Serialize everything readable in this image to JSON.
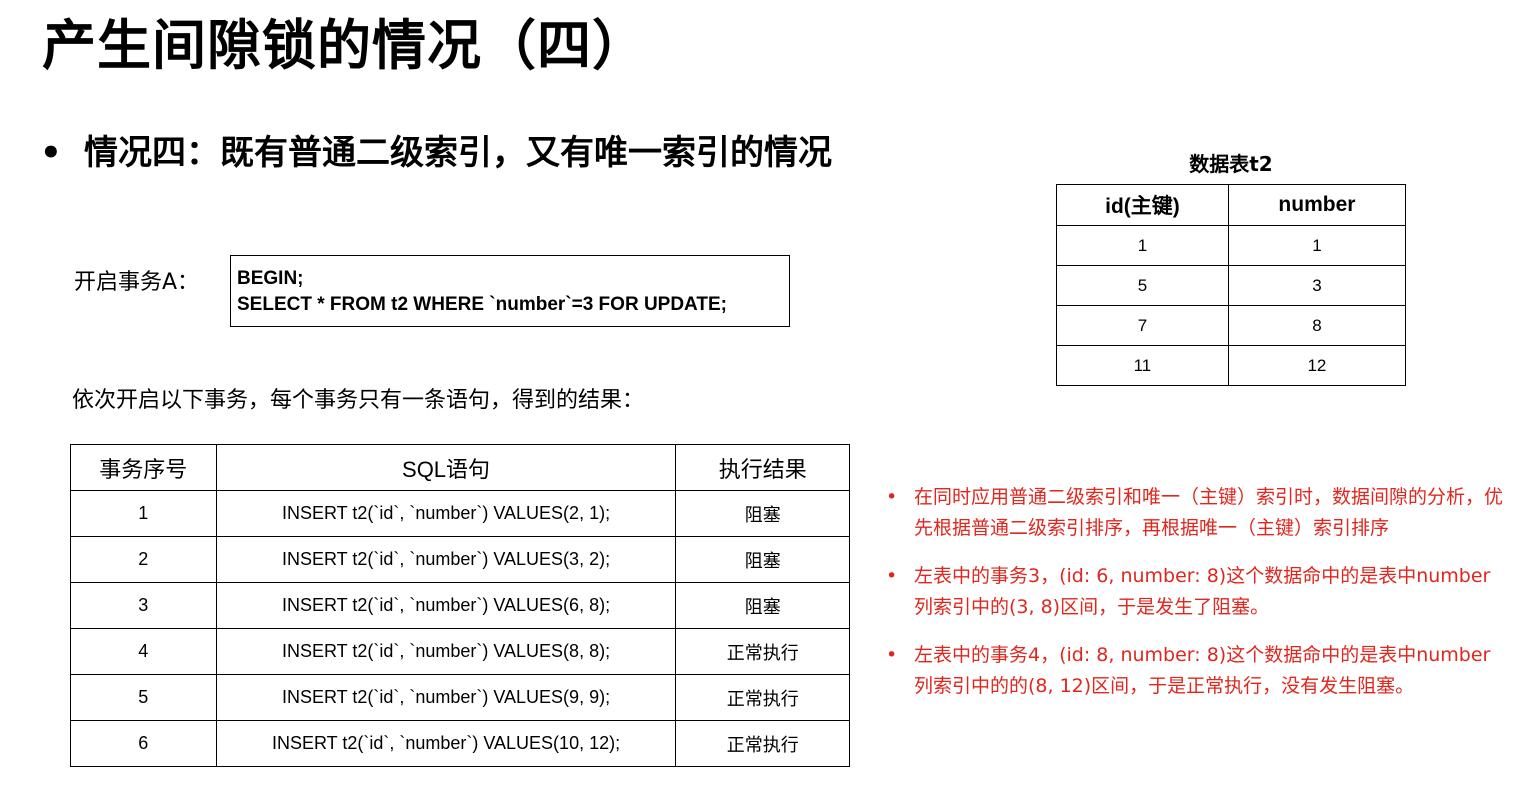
{
  "title": "产生间隙锁的情况（四）",
  "bullet": {
    "dot": "•",
    "text": "情况四：既有普通二级索引，又有唯一索引的情况"
  },
  "transaction_a": {
    "label": "开启事务A：",
    "line1": "BEGIN;",
    "line2": "SELECT * FROM t2 WHERE `number`=3 FOR UPDATE;"
  },
  "intro": "依次开启以下事务，每个事务只有一条语句，得到的结果：",
  "main_table": {
    "headers": [
      "事务序号",
      "SQL语句",
      "执行结果"
    ],
    "rows": [
      [
        "1",
        "INSERT t2(`id`, `number`) VALUES(2, 1);",
        "阻塞"
      ],
      [
        "2",
        "INSERT t2(`id`, `number`) VALUES(3, 2);",
        "阻塞"
      ],
      [
        "3",
        "INSERT t2(`id`, `number`) VALUES(6, 8);",
        "阻塞"
      ],
      [
        "4",
        "INSERT t2(`id`, `number`) VALUES(8, 8);",
        "正常执行"
      ],
      [
        "5",
        "INSERT t2(`id`, `number`) VALUES(9, 9);",
        "正常执行"
      ],
      [
        "6",
        "INSERT t2(`id`, `number`) VALUES(10, 12);",
        "正常执行"
      ]
    ]
  },
  "t2_table": {
    "caption": "数据表t2",
    "headers": [
      "id(主键)",
      "number"
    ],
    "rows": [
      [
        "1",
        "1"
      ],
      [
        "5",
        "3"
      ],
      [
        "7",
        "8"
      ],
      [
        "11",
        "12"
      ]
    ]
  },
  "notes": {
    "color": "#e0271e",
    "dot": "•",
    "items": [
      "在同时应用普通二级索引和唯一（主键）索引时，数据间隙的分析，优先根据普通二级索引排序，再根据唯一（主键）索引排序",
      "左表中的事务3，(id: 6, number: 8)这个数据命中的是表中number列索引中的(3, 8)区间，于是发生了阻塞。",
      "左表中的事务4，(id: 8, number: 8)这个数据命中的是表中number列索引中的的(8, 12)区间，于是正常执行，没有发生阻塞。"
    ]
  }
}
